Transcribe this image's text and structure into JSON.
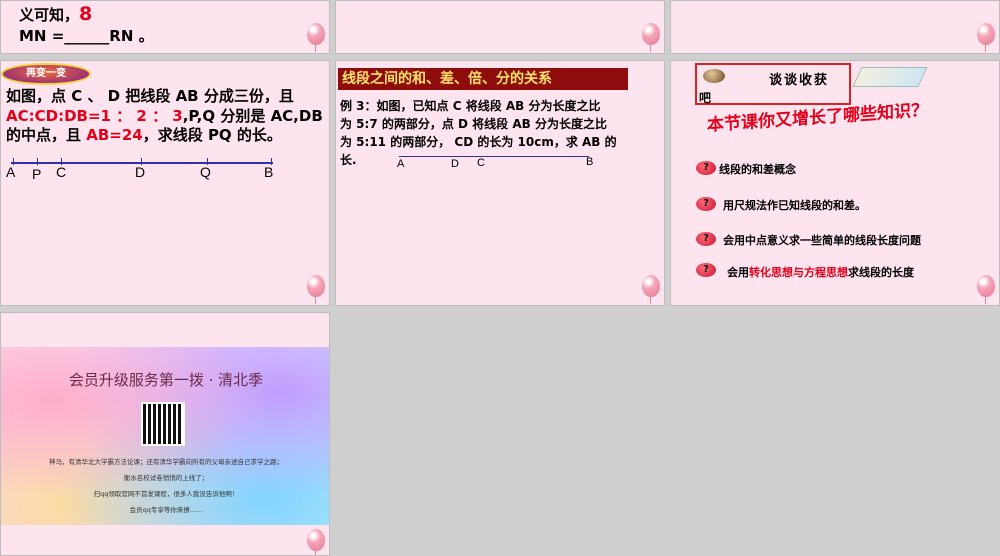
{
  "slide1": {
    "line1": "义可知，",
    "line1_num": "8",
    "line2": "MN =______RN 。"
  },
  "slide4": {
    "badge": "再变一变",
    "text_a": "如图，点 C 、 D 把线段 AB 分成三份，且",
    "ratio": "AC:CD:DB=1 ： 2 ： 3",
    "text_b": ",P,Q 分别是 AC,DB",
    "text_c": "的中点，且 ",
    "ab_value": "AB=24",
    "text_d": "，求线段 PQ 的长。",
    "points": [
      "A",
      "P",
      "C",
      "D",
      "Q",
      "B"
    ]
  },
  "slide5": {
    "header": "线段之间的和、差、倍、分的关系",
    "example": [
      "例 3：如图，已知点 C 将线段 AB 分为长度之比",
      "为 5:7 的两部分，点 D 将线段 AB 分为长度之比",
      "为 5:11 的两部分， CD 的长为 10cm，求 AB 的",
      "长."
    ],
    "points": [
      "A",
      "D",
      "C",
      "B"
    ]
  },
  "slide6": {
    "title_a": "谈谈收获",
    "title_b": "吧",
    "question": "本节课你又增长了哪些知识？",
    "items": [
      "线段的和差概念",
      "用尺规法作已知线段的和差。",
      "会用中点意义求一些简单的线段长度问题"
    ],
    "item4_pre": "会用",
    "item4_red": "转化思想与方程思想",
    "item4_post": "求线段的长度"
  },
  "slide7": {
    "title": "会员升级服务第一拨 · 清北季",
    "lines": [
      "神马，有清华北大学霸方法论课；还有清华学霸向所有的父母亲述自己求学之路；",
      "衡水名校试卷悄悄的上线了；",
      "扫qq领取官网不首发课程，很多人我没告诉他啊！",
      "会员qq专享等你来撩......"
    ]
  }
}
